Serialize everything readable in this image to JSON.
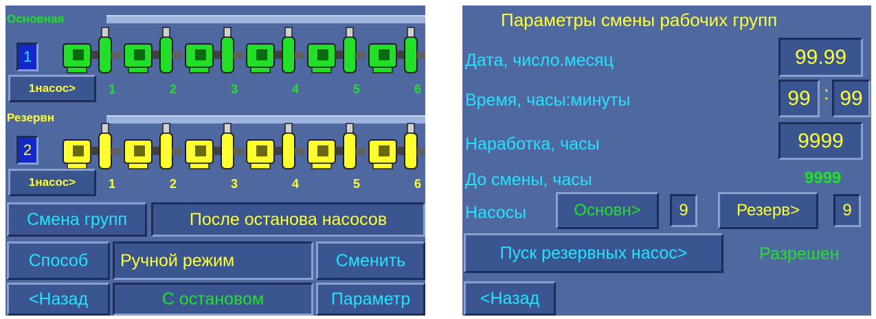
{
  "left": {
    "main_group": {
      "label": "Основная",
      "number": "1",
      "pump_button": "1насос>",
      "pump_numbers": [
        "1",
        "2",
        "3",
        "4",
        "5",
        "6"
      ],
      "color": "#22e02a"
    },
    "reserve_group": {
      "label": "Резервн",
      "number": "2",
      "pump_button": "1насос>",
      "pump_numbers": [
        "1",
        "2",
        "3",
        "4",
        "5",
        "6"
      ],
      "color": "#ffff30"
    },
    "change_groups_button": "Смена групп",
    "change_groups_value": "После останова насосов",
    "method_label": "Способ",
    "method_value": "Ручной режим",
    "change_button": "Сменить",
    "back_button": "<Назад",
    "stop_mode_value": "С остановом",
    "params_button": "Параметр"
  },
  "right": {
    "title": "Параметры смены рабочих групп",
    "date_label": "Дата, число.месяц",
    "date_value": "99.99",
    "time_label": "Время, часы:минуты",
    "time_hours": "99",
    "time_sep": ":",
    "time_minutes": "99",
    "runtime_label": "Наработка, часы",
    "runtime_value": "9999",
    "until_change_label": "До смены, часы",
    "until_change_value": "9999",
    "pumps_label": "Насосы",
    "main_button": "Основн>",
    "main_count": "9",
    "reserve_button": "Резерв>",
    "reserve_count": "9",
    "start_reserve_button": "Пуск резервных насос>",
    "start_reserve_status": "Разрешен",
    "back_button": "<Назад"
  },
  "colors": {
    "panel_bg": "#5068a0",
    "text_cyan": "#22e4ff",
    "text_yellow": "#ffff30",
    "text_green": "#22e02a"
  }
}
